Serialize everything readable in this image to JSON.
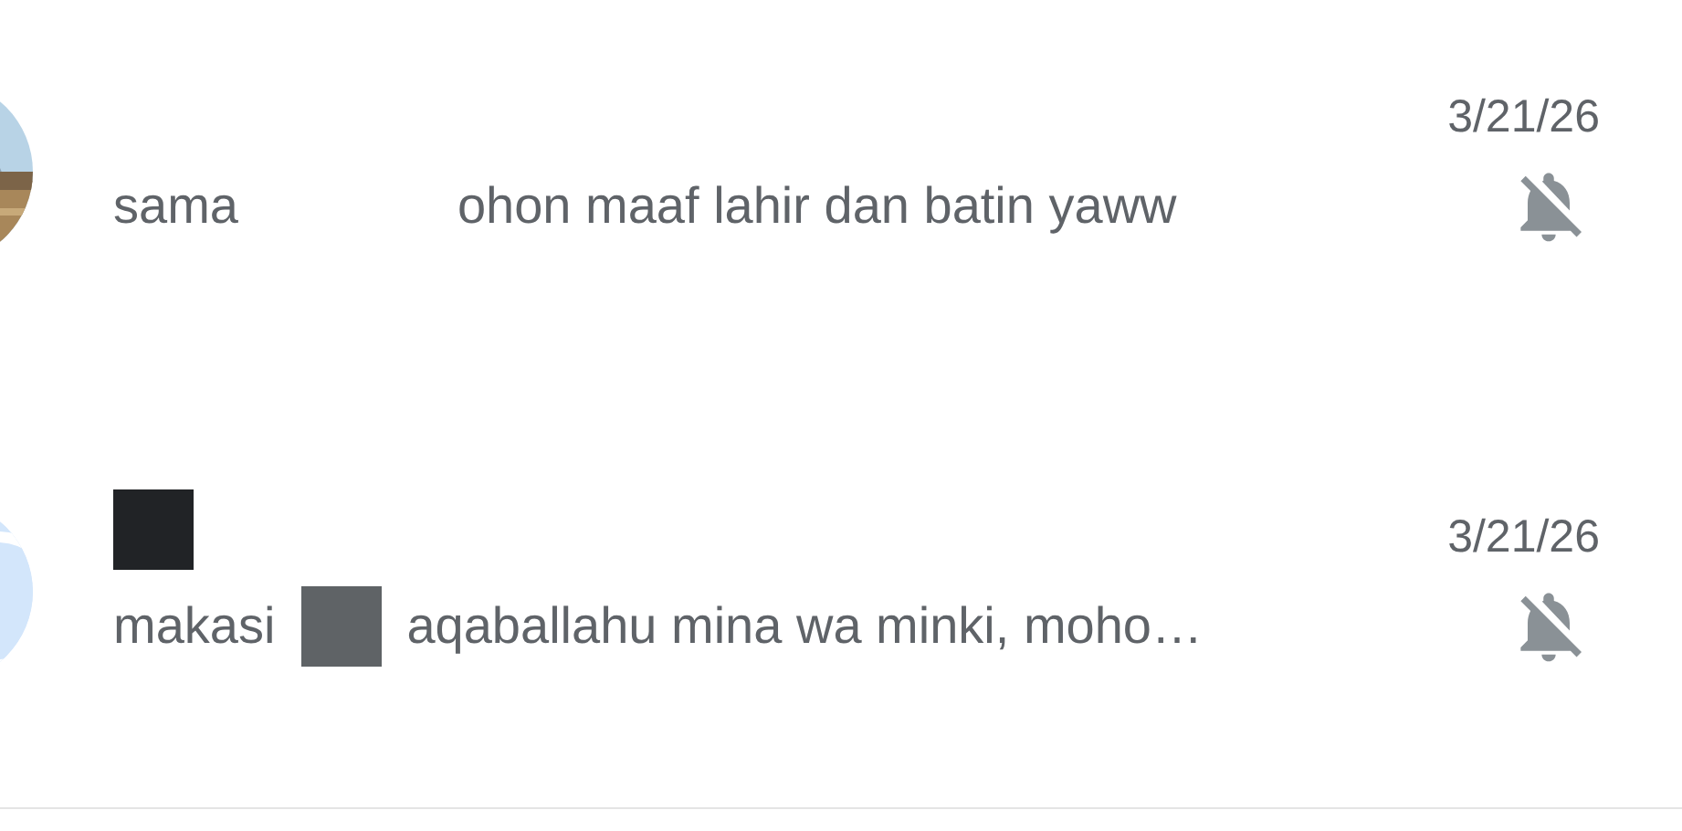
{
  "chats": [
    {
      "name_hidden": false,
      "date": "3/21/26",
      "muted": true,
      "message": [
        {
          "kind": "text",
          "text": "sama"
        },
        {
          "kind": "gap"
        },
        {
          "kind": "text",
          "text": "ohon maaf lahir dan batin yaww"
        }
      ]
    },
    {
      "avatar": {
        "kind": "placeholder"
      },
      "name_hidden": true,
      "date": "3/21/26",
      "muted": true,
      "message": [
        {
          "kind": "text",
          "text": "makasi"
        },
        {
          "kind": "redaction",
          "color": "#5f6366"
        },
        {
          "kind": "text",
          "text": "aqaballahu mina wa minki, moho…"
        }
      ]
    }
  ]
}
